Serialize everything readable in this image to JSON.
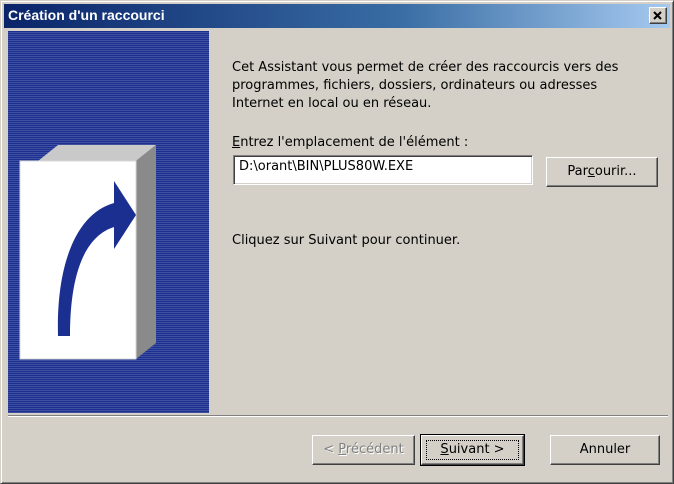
{
  "window": {
    "title": "Création d'un raccourci"
  },
  "banner": {
    "icon": "shortcut-arrow-icon",
    "colors": {
      "background": "#1a2f8f",
      "card": "#ffffff",
      "arrow": "#1a2f8f"
    }
  },
  "intro": {
    "text": "Cet Assistant vous permet de créer des raccourcis vers des programmes, fichiers, dossiers, ordinateurs ou adresses Internet en local ou en réseau."
  },
  "location": {
    "label_mnemonic": "E",
    "label_rest": "ntrez l'emplacement de l'élément :",
    "value": "D:\\orant\\BIN\\PLUS80W.EXE",
    "browse_pre": "Par",
    "browse_mnemonic": "c",
    "browse_post": "ourir..."
  },
  "instruction": "Cliquez sur Suivant pour continuer.",
  "buttons": {
    "prev_pre": "< ",
    "prev_mnemonic": "P",
    "prev_post": "récédent",
    "next_mnemonic": "S",
    "next_post": "uivant >",
    "cancel": "Annuler"
  }
}
